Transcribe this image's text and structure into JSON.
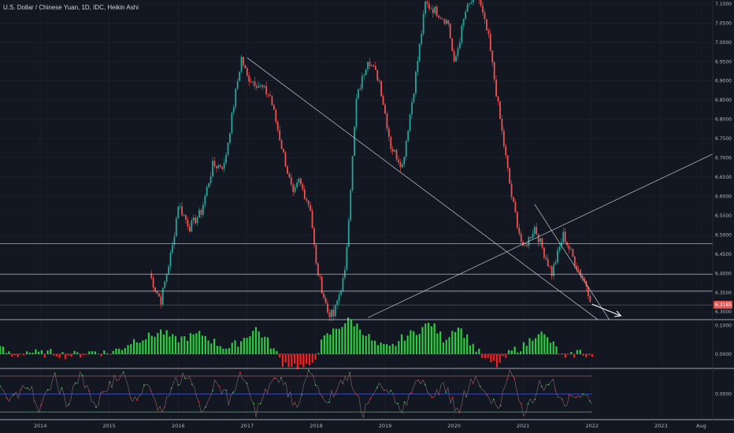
{
  "header": {
    "symbol": "U.S. Dollar / Chinese Yuan",
    "interval": "1D",
    "source": "IDC",
    "chart_style": "Heikin Ashi"
  },
  "colors": {
    "background": "#131722",
    "bull": "#26a69a",
    "bear": "#ef5350",
    "osc_up": "#2ecc40",
    "osc_down": "#ff1e1e",
    "price_badge": "#ef5350",
    "line": "#c8ccd4"
  },
  "price_axis": {
    "labels": [
      "7.1000",
      "7.0500",
      "7.0000",
      "6.9500",
      "6.9000",
      "6.8500",
      "6.8000",
      "6.7500",
      "6.7000",
      "6.6500",
      "6.6000",
      "6.5500",
      "6.5000",
      "6.4500",
      "6.4000",
      "6.3500",
      "6.3000"
    ],
    "current_price": "6.3185"
  },
  "osc1_axis": {
    "labels": [
      "0.1000",
      "0.0000"
    ]
  },
  "osc2_axis": {
    "labels": [
      "0.0000"
    ]
  },
  "time_axis": {
    "labels": [
      "2014",
      "2015",
      "2016",
      "2017",
      "2018",
      "2019",
      "2020",
      "2021",
      "2022",
      "2023",
      "Aug"
    ]
  },
  "chart_data": {
    "type": "candlestick",
    "title": "U.S. Dollar / Chinese Yuan, 1D, IDC, Heikin Ashi",
    "x_range": [
      "2013-06",
      "2023-10"
    ],
    "ylim": [
      6.28,
      7.11
    ],
    "series": [
      {
        "x": [
          "2015-08",
          "2015-09",
          "2015-10",
          "2015-12",
          "2016-01",
          "2016-03",
          "2016-05",
          "2016-07",
          "2016-09",
          "2016-11",
          "2016-12",
          "2017-01",
          "2017-03",
          "2017-05",
          "2017-07",
          "2017-09",
          "2017-10",
          "2017-12",
          "2018-01",
          "2018-03",
          "2018-04",
          "2018-06",
          "2018-08",
          "2018-10",
          "2018-12",
          "2019-02",
          "2019-04",
          "2019-06",
          "2019-08",
          "2019-10",
          "2019-12",
          "2020-01",
          "2020-03",
          "2020-05",
          "2020-07",
          "2020-09",
          "2020-11",
          "2021-01",
          "2021-03",
          "2021-04",
          "2021-06",
          "2021-08",
          "2021-10",
          "2021-12",
          "2022-01"
        ],
        "y": [
          6.4,
          6.36,
          6.33,
          6.47,
          6.58,
          6.52,
          6.56,
          6.68,
          6.68,
          6.87,
          6.96,
          6.91,
          6.89,
          6.86,
          6.73,
          6.6,
          6.64,
          6.57,
          6.42,
          6.3,
          6.29,
          6.4,
          6.85,
          6.96,
          6.9,
          6.73,
          6.68,
          6.88,
          7.1,
          7.08,
          7.05,
          6.94,
          7.08,
          7.13,
          7.01,
          6.8,
          6.6,
          6.46,
          6.52,
          6.48,
          6.4,
          6.5,
          6.43,
          6.37,
          6.32
        ]
      }
    ],
    "levels": [
      6.477,
      6.398,
      6.354,
      6.318
    ],
    "trendlines": [
      {
        "from": [
          "2017-01",
          6.96
        ],
        "to": [
          "2022-02",
          6.28
        ]
      },
      {
        "from": [
          "2021-03",
          6.58
        ],
        "to": [
          "2022-04",
          6.28
        ]
      },
      {
        "from": [
          "2018-10",
          6.285
        ],
        "to": [
          "2023-10",
          6.71
        ]
      }
    ],
    "arrow": {
      "from": [
        "2022-01",
        6.32
      ],
      "to": [
        "2022-06",
        6.29
      ]
    },
    "osc1": {
      "range": [
        -0.05,
        0.12
      ],
      "values": [
        0.02,
        -0.01,
        0.01,
        0,
        0.005,
        -0.005,
        0,
        0.01,
        0.003,
        0.02,
        0.05,
        0.06,
        0.08,
        0.05,
        0.06,
        0.07,
        0.04,
        0.02,
        0.05,
        0.09,
        0.04,
        -0.03,
        -0.04,
        -0.05,
        0.05,
        0.09,
        0.12,
        0.08,
        0.03,
        0.02,
        0.06,
        0.08,
        0.11,
        0.05,
        0.1,
        0.04,
        -0.02,
        -0.04,
        0.01,
        0.03,
        0.08,
        0.04,
        -0.02,
        0.01,
        -0.01
      ]
    },
    "osc2": {
      "range": [
        -1,
        1
      ],
      "bands": [
        0.7,
        0,
        -0.7
      ],
      "values": [
        0.3,
        -0.2,
        0.5,
        -0.6,
        0.7,
        -0.4,
        0.8,
        -0.5,
        0.2,
        0.9,
        -0.3,
        0.6,
        -0.8,
        0.4,
        0.7,
        -0.6,
        0.5,
        -0.2,
        0.8,
        -0.7,
        0.3,
        0.6,
        -0.5,
        0.9,
        -0.4,
        0.2,
        0.7,
        -0.8,
        0.5,
        0.1,
        -0.6,
        0.8,
        -0.3,
        0.4,
        -0.7,
        0.6,
        0.2,
        -0.5,
        0.9,
        -0.8,
        0.3,
        0.5,
        -0.4,
        0.1,
        -0.2
      ]
    }
  }
}
